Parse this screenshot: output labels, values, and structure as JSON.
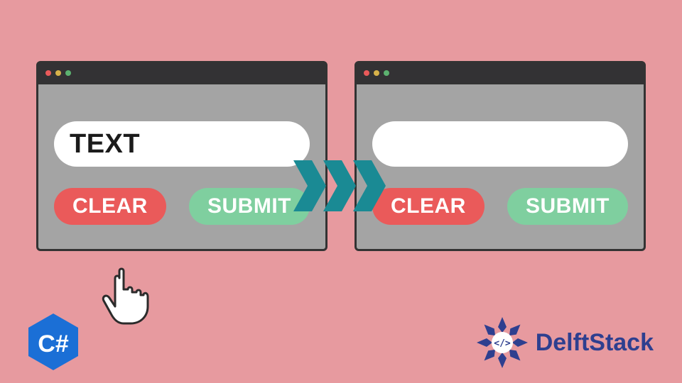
{
  "colors": {
    "background": "#e79a9f",
    "window_body": "#a4a4a4",
    "window_border": "#333333",
    "titlebar": "#333234",
    "dot_red": "#ea5a5a",
    "dot_yellow": "#d7b24a",
    "dot_green": "#5cb270",
    "clear_btn": "#ea5a5a",
    "submit_btn": "#7fcf9f",
    "arrow": "#1a8a94",
    "csharp_badge": "#1b6fd6",
    "delft_brand": "#2e3f8f"
  },
  "left_window": {
    "textbox_value": "TEXT",
    "clear_label": "CLEAR",
    "submit_label": "SUBMIT"
  },
  "right_window": {
    "textbox_value": "",
    "clear_label": "CLEAR",
    "submit_label": "SUBMIT"
  },
  "csharp_label": "C#",
  "brand_name": "DelftStack"
}
